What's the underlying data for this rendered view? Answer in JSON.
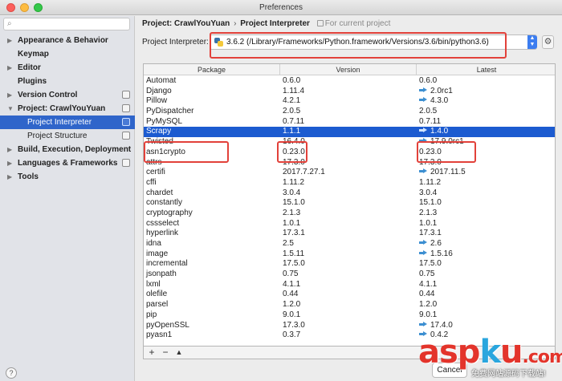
{
  "window": {
    "title": "Preferences"
  },
  "sidebar": {
    "items": [
      {
        "label": "Appearance & Behavior",
        "arrow": "▶",
        "config": false,
        "child": false,
        "selected": false
      },
      {
        "label": "Keymap",
        "arrow": "",
        "config": false,
        "child": false,
        "selected": false
      },
      {
        "label": "Editor",
        "arrow": "▶",
        "config": false,
        "child": false,
        "selected": false
      },
      {
        "label": "Plugins",
        "arrow": "",
        "config": false,
        "child": false,
        "selected": false
      },
      {
        "label": "Version Control",
        "arrow": "▶",
        "config": true,
        "child": false,
        "selected": false
      },
      {
        "label": "Project: CrawlYouYuan",
        "arrow": "▼",
        "config": true,
        "child": false,
        "selected": false
      },
      {
        "label": "Project Interpreter",
        "arrow": "",
        "config": true,
        "child": true,
        "selected": true
      },
      {
        "label": "Project Structure",
        "arrow": "",
        "config": true,
        "child": true,
        "selected": false
      },
      {
        "label": "Build, Execution, Deployment",
        "arrow": "▶",
        "config": false,
        "child": false,
        "selected": false
      },
      {
        "label": "Languages & Frameworks",
        "arrow": "▶",
        "config": true,
        "child": false,
        "selected": false
      },
      {
        "label": "Tools",
        "arrow": "▶",
        "config": false,
        "child": false,
        "selected": false
      }
    ],
    "help_label": "?"
  },
  "breadcrumb": {
    "project": "Project: CrawlYouYuan",
    "separator": "›",
    "page": "Project Interpreter",
    "note": "For current project"
  },
  "interpreter": {
    "label": "Project Interpreter:",
    "value": "3.6.2 (/Library/Frameworks/Python.framework/Versions/3.6/bin/python3.6)"
  },
  "table": {
    "columns": [
      "Package",
      "Version",
      "Latest"
    ],
    "rows": [
      {
        "package": "Automat",
        "version": "0.6.0",
        "latest": "0.6.0",
        "upgrade": false,
        "selected": false
      },
      {
        "package": "Django",
        "version": "1.11.4",
        "latest": "2.0rc1",
        "upgrade": true,
        "selected": false
      },
      {
        "package": "Pillow",
        "version": "4.2.1",
        "latest": "4.3.0",
        "upgrade": true,
        "selected": false
      },
      {
        "package": "PyDispatcher",
        "version": "2.0.5",
        "latest": "2.0.5",
        "upgrade": false,
        "selected": false
      },
      {
        "package": "PyMySQL",
        "version": "0.7.11",
        "latest": "0.7.11",
        "upgrade": false,
        "selected": false
      },
      {
        "package": "Scrapy",
        "version": "1.1.1",
        "latest": "1.4.0",
        "upgrade": true,
        "selected": true
      },
      {
        "package": "Twisted",
        "version": "16.4.0",
        "latest": "17.9.0rc1",
        "upgrade": true,
        "selected": false
      },
      {
        "package": "asn1crypto",
        "version": "0.23.0",
        "latest": "0.23.0",
        "upgrade": false,
        "selected": false
      },
      {
        "package": "attrs",
        "version": "17.3.0",
        "latest": "17.3.0",
        "upgrade": false,
        "selected": false
      },
      {
        "package": "certifi",
        "version": "2017.7.27.1",
        "latest": "2017.11.5",
        "upgrade": true,
        "selected": false
      },
      {
        "package": "cffi",
        "version": "1.11.2",
        "latest": "1.11.2",
        "upgrade": false,
        "selected": false
      },
      {
        "package": "chardet",
        "version": "3.0.4",
        "latest": "3.0.4",
        "upgrade": false,
        "selected": false
      },
      {
        "package": "constantly",
        "version": "15.1.0",
        "latest": "15.1.0",
        "upgrade": false,
        "selected": false
      },
      {
        "package": "cryptography",
        "version": "2.1.3",
        "latest": "2.1.3",
        "upgrade": false,
        "selected": false
      },
      {
        "package": "cssselect",
        "version": "1.0.1",
        "latest": "1.0.1",
        "upgrade": false,
        "selected": false
      },
      {
        "package": "hyperlink",
        "version": "17.3.1",
        "latest": "17.3.1",
        "upgrade": false,
        "selected": false
      },
      {
        "package": "idna",
        "version": "2.5",
        "latest": "2.6",
        "upgrade": true,
        "selected": false
      },
      {
        "package": "image",
        "version": "1.5.11",
        "latest": "1.5.16",
        "upgrade": true,
        "selected": false
      },
      {
        "package": "incremental",
        "version": "17.5.0",
        "latest": "17.5.0",
        "upgrade": false,
        "selected": false
      },
      {
        "package": "jsonpath",
        "version": "0.75",
        "latest": "0.75",
        "upgrade": false,
        "selected": false
      },
      {
        "package": "lxml",
        "version": "4.1.1",
        "latest": "4.1.1",
        "upgrade": false,
        "selected": false
      },
      {
        "package": "olefile",
        "version": "0.44",
        "latest": "0.44",
        "upgrade": false,
        "selected": false
      },
      {
        "package": "parsel",
        "version": "1.2.0",
        "latest": "1.2.0",
        "upgrade": false,
        "selected": false
      },
      {
        "package": "pip",
        "version": "9.0.1",
        "latest": "9.0.1",
        "upgrade": false,
        "selected": false
      },
      {
        "package": "pyOpenSSL",
        "version": "17.3.0",
        "latest": "17.4.0",
        "upgrade": true,
        "selected": false
      },
      {
        "package": "pyasn1",
        "version": "0.3.7",
        "latest": "0.4.2",
        "upgrade": true,
        "selected": false
      }
    ]
  },
  "toolbar": {
    "add": "+",
    "remove": "−",
    "upgrade": "▲"
  },
  "footer": {
    "cancel_label": "Cancel"
  },
  "watermark": {
    "brand_a": "asp",
    "brand_dot": "k",
    "brand_b": "u",
    "suffix": ".com",
    "sub": "免费网站源码下载站!"
  },
  "colors": {
    "selection": "#1c5bd0",
    "sidebar_selection": "#2f65ca",
    "annotation": "#e2413a",
    "upgrade_arrow": "#3d8fd1"
  }
}
